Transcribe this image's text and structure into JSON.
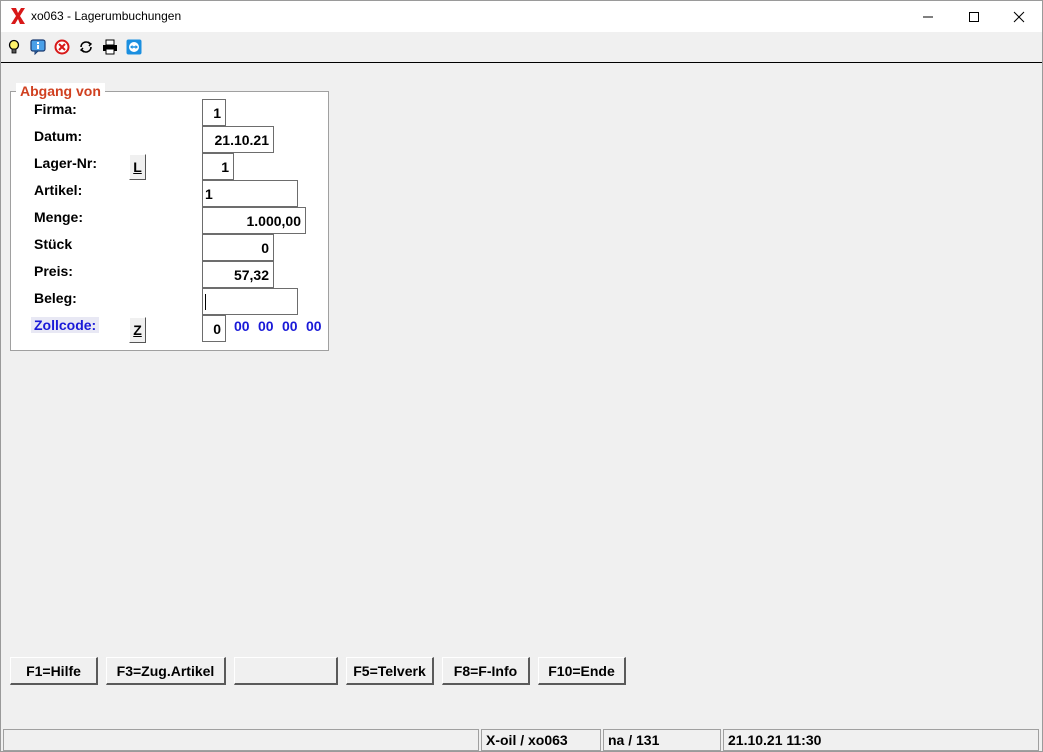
{
  "window": {
    "title": "xo063 - Lagerumbuchungen",
    "app_icon": "x-logo-icon",
    "accent_red": "#d81818"
  },
  "toolbar": {
    "icons": [
      "lightbulb-icon",
      "info-icon",
      "close-circle-icon",
      "refresh-icon",
      "printer-icon",
      "teamviewer-icon"
    ]
  },
  "group": {
    "legend": "Abgang von",
    "legend_color": "#d04020"
  },
  "form": {
    "firma": {
      "label": "Firma:",
      "value": "1"
    },
    "datum": {
      "label": "Datum:",
      "value": "21.10.21"
    },
    "lager": {
      "label": "Lager-Nr:",
      "value": "1",
      "button": "L"
    },
    "artikel": {
      "label": "Artikel:",
      "value": "1"
    },
    "menge": {
      "label": "Menge:",
      "value": "1.000,00"
    },
    "stueck": {
      "label": "Stück",
      "value": "0"
    },
    "preis": {
      "label": "Preis:",
      "value": "57,32"
    },
    "beleg": {
      "label": "Beleg:",
      "value": ""
    },
    "zollcode": {
      "label": "Zollcode:",
      "value": "0",
      "button": "Z",
      "codes": [
        "00",
        "00",
        "00",
        "00"
      ]
    }
  },
  "fkeys": [
    "F1=Hilfe",
    "F3=Zug.Artikel",
    "",
    "F5=Telverk",
    "F8=F-Info",
    "F10=Ende"
  ],
  "status": {
    "app": "X-oil / xo063",
    "user": "na / 131",
    "datetime": "21.10.21 11:30"
  }
}
